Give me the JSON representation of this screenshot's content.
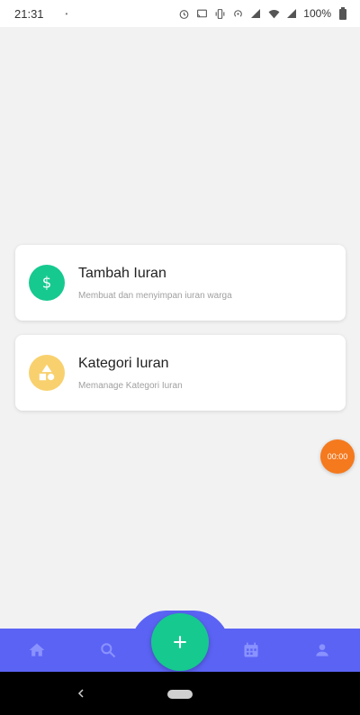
{
  "status_bar": {
    "time": "21:31",
    "dot": "•",
    "battery_percent": "100%",
    "icons": [
      "alarm-icon",
      "cast-icon",
      "vibrate-icon",
      "hotspot-icon",
      "signal-icon",
      "wifi-icon",
      "signal-icon",
      "battery-icon"
    ]
  },
  "menu": {
    "items": [
      {
        "title": "Tambah Iuran",
        "subtitle": "Membuat dan menyimpan iuran warga",
        "icon": "dollar-icon",
        "color": "#16c98f"
      },
      {
        "title": "Kategori Iuran",
        "subtitle": "Memanage Kategori Iuran",
        "icon": "shapes-icon",
        "color": "#f8d16e"
      }
    ]
  },
  "timer": {
    "label": "00:00",
    "color": "#f5791d"
  },
  "bottom_nav": {
    "color": "#5b63f5",
    "items": [
      "home-icon",
      "search-icon",
      "add-icon",
      "calendar-icon",
      "person-icon"
    ],
    "fab_color": "#16c98f"
  }
}
